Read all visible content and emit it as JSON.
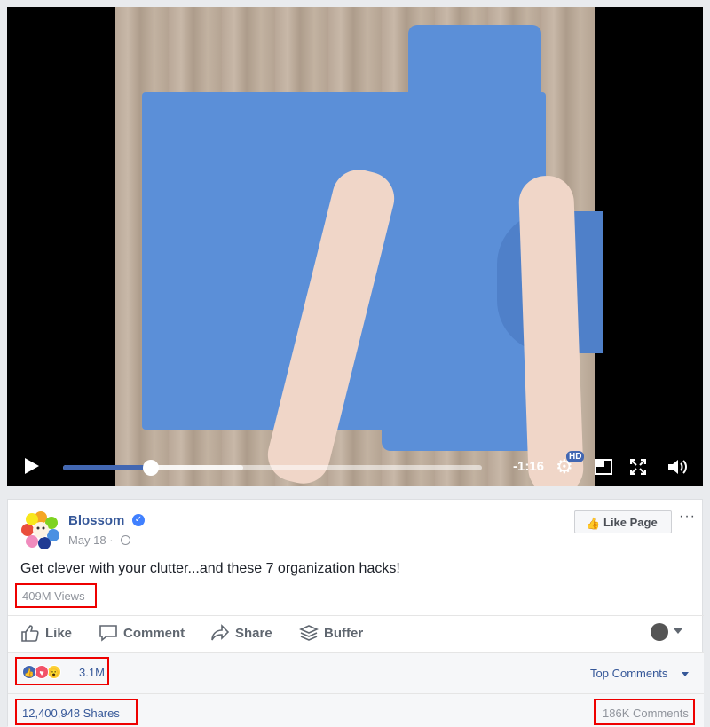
{
  "video": {
    "time_remaining": "-1:16",
    "hd_label": "HD",
    "progress_fraction": 0.21,
    "buffered_fraction": 0.43
  },
  "post": {
    "page_name": "Blossom",
    "date": "May 18 ·",
    "like_page_label": "Like Page",
    "more_label": "···",
    "text": "Get clever with your clutter...and these 7 organization hacks!",
    "views": "409M Views"
  },
  "actions": {
    "like": "Like",
    "comment": "Comment",
    "share": "Share",
    "buffer": "Buffer"
  },
  "reactions": {
    "count": "3.1M",
    "types": [
      "like",
      "love",
      "wow"
    ],
    "top_comments_label": "Top Comments"
  },
  "stats": {
    "shares": "12,400,948 Shares",
    "comments": "186K Comments"
  },
  "colors": {
    "link_blue": "#365899",
    "brand_blue": "#4267b2",
    "highlight_red": "#ee0000"
  }
}
